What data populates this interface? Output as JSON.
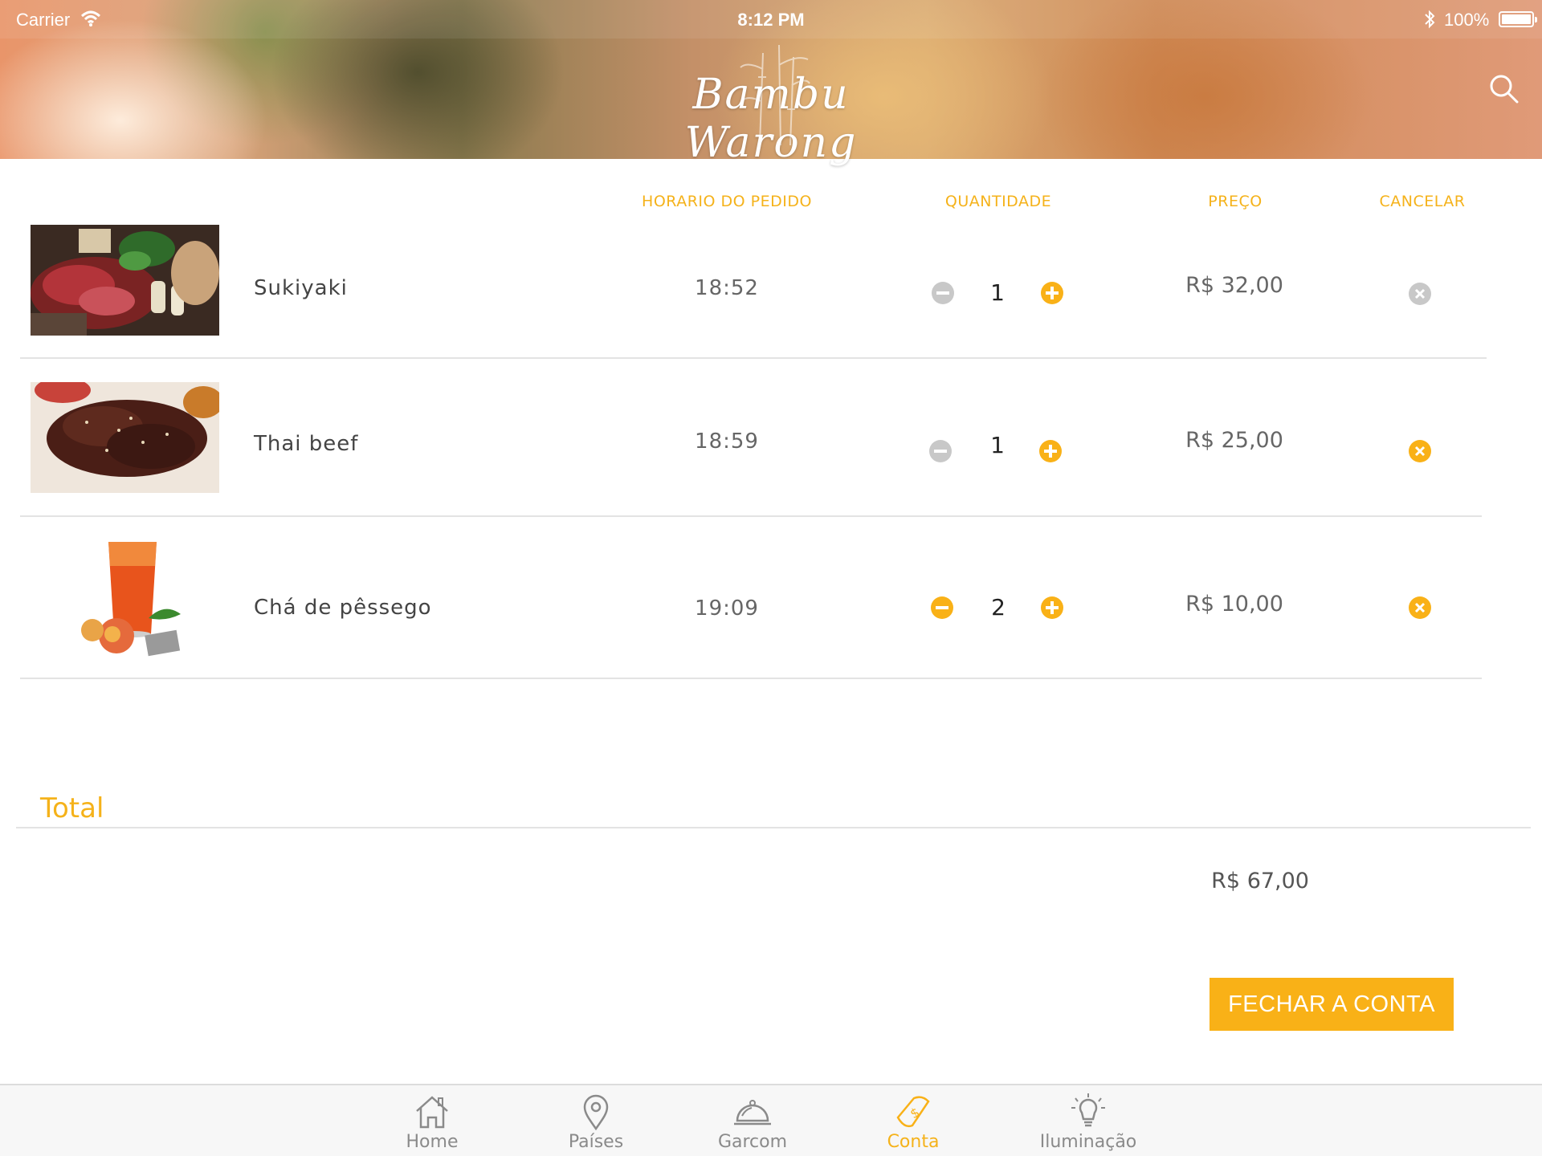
{
  "status_bar": {
    "carrier": "Carrier",
    "time": "8:12 PM",
    "battery": "100%",
    "battery_level": 1.0
  },
  "header": {
    "logo_text": "Bambu Warong",
    "search_icon": "search-icon"
  },
  "columns": {
    "time": "HORARIO DO PEDIDO",
    "quantity": "QUANTIDADE",
    "price": "PREÇO",
    "cancel": "CANCELAR"
  },
  "orders": [
    {
      "name": "Sukiyaki",
      "time": "18:52",
      "quantity": "1",
      "price": "R$ 32,00",
      "minus_active": false,
      "cancel_active": false
    },
    {
      "name": "Thai beef",
      "time": "18:59",
      "quantity": "1",
      "price": "R$ 25,00",
      "minus_active": false,
      "cancel_active": true
    },
    {
      "name": "Chá de pêssego",
      "time": "19:09",
      "quantity": "2",
      "price": "R$ 10,00",
      "minus_active": true,
      "cancel_active": true
    }
  ],
  "total": {
    "label": "Total",
    "value": "R$ 67,00"
  },
  "close_button": "FECHAR A CONTA",
  "tabs": [
    {
      "label": "Home",
      "icon": "home-icon",
      "active": false
    },
    {
      "label": "Países",
      "icon": "map-pin-icon",
      "active": false
    },
    {
      "label": "Garcom",
      "icon": "cloche-icon",
      "active": false
    },
    {
      "label": "Conta",
      "icon": "bill-icon",
      "active": true
    },
    {
      "label": "Iluminação",
      "icon": "lightbulb-icon",
      "active": false
    }
  ],
  "colors": {
    "accent": "#f9b117",
    "inactive_control": "#c8c8c8",
    "tab_inactive": "#8a8a8a"
  }
}
